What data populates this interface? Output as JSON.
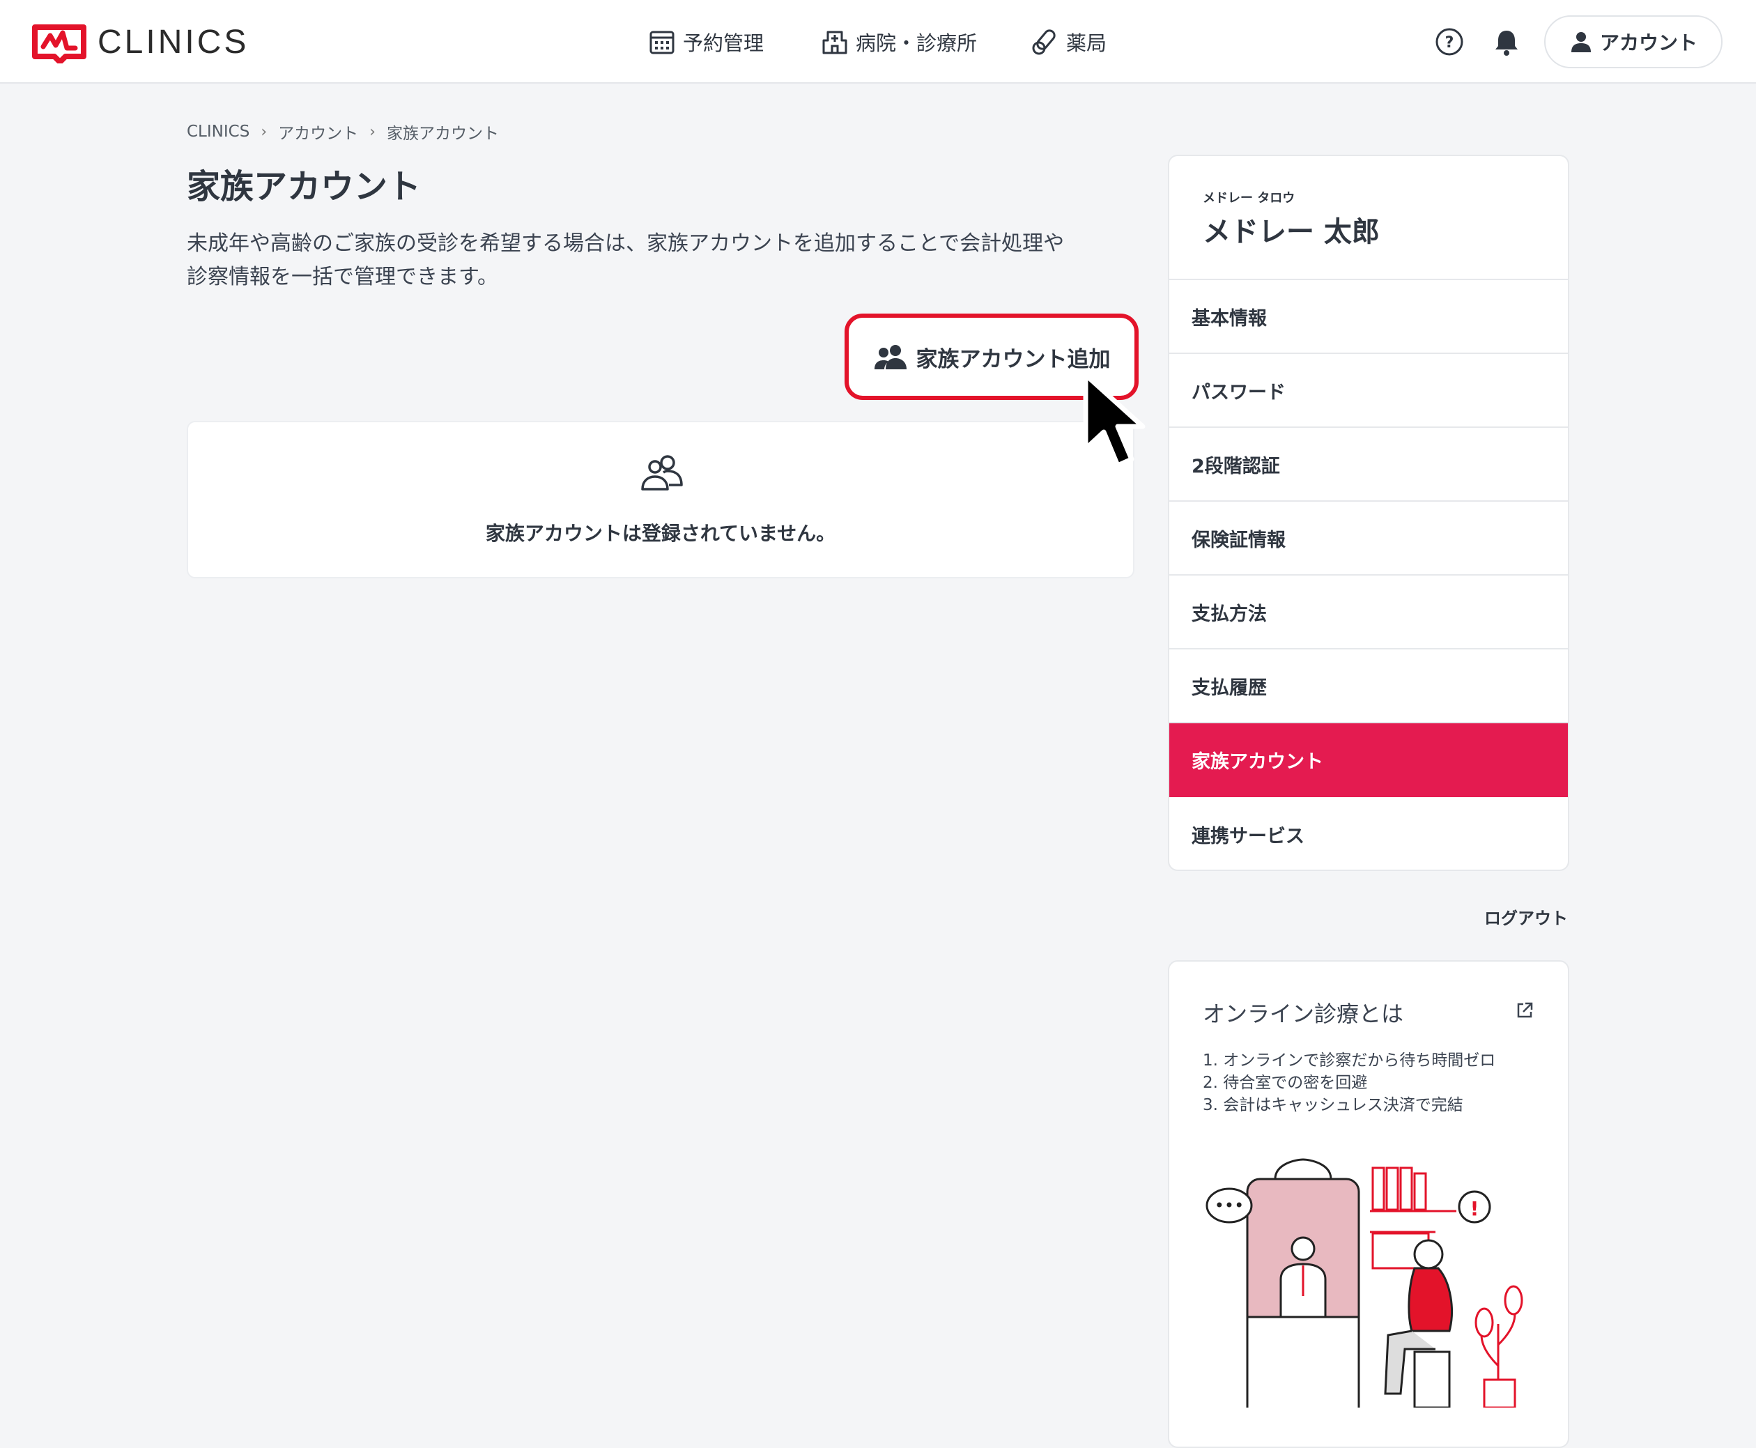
{
  "header": {
    "brand": "CLINICS",
    "nav": [
      {
        "label": "予約管理",
        "icon": "calendar-icon"
      },
      {
        "label": "病院・診療所",
        "icon": "hospital-icon"
      },
      {
        "label": "薬局",
        "icon": "pill-icon"
      }
    ],
    "account_label": "アカウント"
  },
  "breadcrumb": [
    "CLINICS",
    "アカウント",
    "家族アカウント"
  ],
  "page": {
    "title": "家族アカウント",
    "description_line1": "未成年や高齢のご家族の受診を希望する場合は、家族アカウントを追加することで会計処理や",
    "description_line2": "診察情報を一括で管理できます。",
    "add_button_label": "家族アカウント追加",
    "empty_message": "家族アカウントは登録されていません。"
  },
  "sidebar": {
    "user_kana": "メドレー タロウ",
    "user_name": "メドレー 太郎",
    "menu": [
      {
        "label": "基本情報",
        "active": false
      },
      {
        "label": "パスワード",
        "active": false
      },
      {
        "label": "2段階認証",
        "active": false
      },
      {
        "label": "保険証情報",
        "active": false
      },
      {
        "label": "支払方法",
        "active": false
      },
      {
        "label": "支払履歴",
        "active": false
      },
      {
        "label": "家族アカウント",
        "active": true
      },
      {
        "label": "連携サービス",
        "active": false
      }
    ],
    "logout_label": "ログアウト"
  },
  "promo": {
    "title": "オンライン診療とは",
    "items": [
      "1. オンラインで診察だから待ち時間ゼロ",
      "2. 待合室での密を回避",
      "3. 会計はキャッシュレス決済で完結"
    ]
  },
  "colors": {
    "accent": "#e41b50",
    "highlight_border": "#e3132a",
    "brand_red": "#e3132a",
    "background": "#f4f5f7",
    "text": "#2f3640"
  }
}
